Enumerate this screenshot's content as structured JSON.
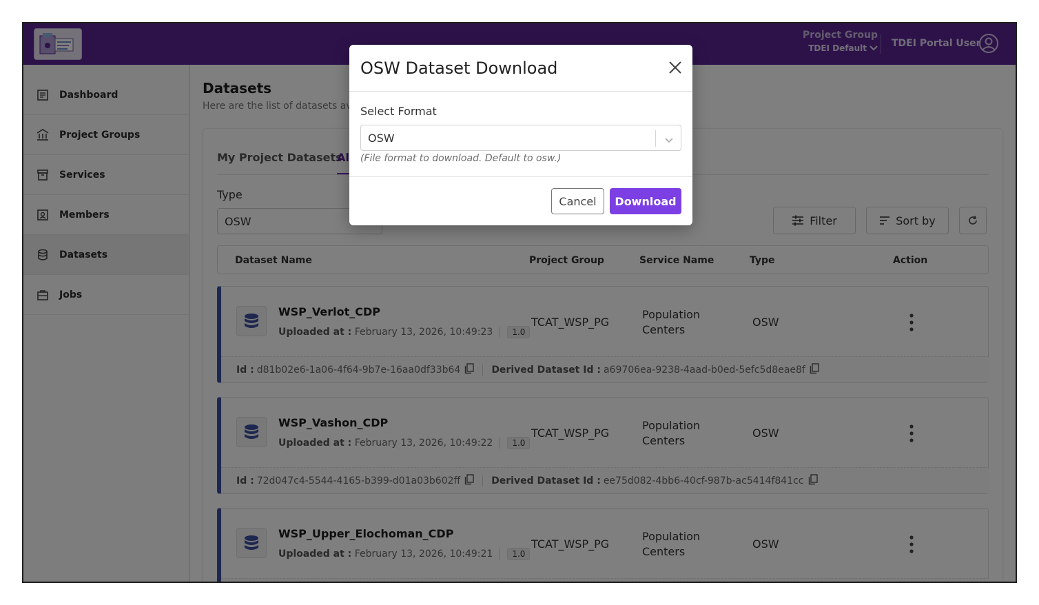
{
  "header": {
    "project_group_label": "Project Group",
    "project_group_value": "TDEI Default",
    "user_name": "TDEI Portal User",
    "brand_color": "#5b2594"
  },
  "sidebar": {
    "items": [
      {
        "label": "Dashboard",
        "icon": "dashboard-icon"
      },
      {
        "label": "Project Groups",
        "icon": "bank-icon"
      },
      {
        "label": "Services",
        "icon": "archive-icon"
      },
      {
        "label": "Members",
        "icon": "member-icon"
      },
      {
        "label": "Datasets",
        "icon": "database-icon",
        "active": true
      },
      {
        "label": "Jobs",
        "icon": "briefcase-icon"
      }
    ]
  },
  "main": {
    "title": "Datasets",
    "subtitle": "Here are the list of datasets av",
    "tabs": [
      "My Project Datasets",
      "Al"
    ],
    "type_label": "Type",
    "type_value": "OSW",
    "filter_label": "Filter",
    "sort_label": "Sort by",
    "columns": [
      "Dataset Name",
      "Project Group",
      "Service Name",
      "Type",
      "Action"
    ],
    "rows": [
      {
        "name": "WSP_Verlot_CDP",
        "uploaded_label": "Uploaded at :",
        "uploaded_at": "February 13, 2026, 10:49:23",
        "version": "1.0",
        "project_group": "TCAT_WSP_PG",
        "service_line1": "Population",
        "service_line2": "Centers",
        "type": "OSW",
        "id_label": "Id :",
        "id": "d81b02e6-1a06-4f64-9b7e-16aa0df33b64",
        "derived_label": "Derived Dataset Id :",
        "derived_id": "a69706ea-9238-4aad-b0ed-5efc5d8eae8f"
      },
      {
        "name": "WSP_Vashon_CDP",
        "uploaded_label": "Uploaded at :",
        "uploaded_at": "February 13, 2026, 10:49:22",
        "version": "1.0",
        "project_group": "TCAT_WSP_PG",
        "service_line1": "Population",
        "service_line2": "Centers",
        "type": "OSW",
        "id_label": "Id :",
        "id": "72d047c4-5544-4165-b399-d01a03b602ff",
        "derived_label": "Derived Dataset Id :",
        "derived_id": "ee75d082-4bb6-40cf-987b-ac5414f841cc"
      },
      {
        "name": "WSP_Upper_Elochoman_CDP",
        "uploaded_label": "Uploaded at :",
        "uploaded_at": "February 13, 2026, 10:49:21",
        "version": "1.0",
        "project_group": "TCAT_WSP_PG",
        "service_line1": "Population",
        "service_line2": "Centers",
        "type": "OSW"
      }
    ]
  },
  "modal": {
    "title": "OSW Dataset Download",
    "select_label": "Select Format",
    "select_value": "OSW",
    "hint": "(File format to download. Default to osw.)",
    "cancel_label": "Cancel",
    "download_label": "Download",
    "download_color": "#7b3fe4"
  }
}
